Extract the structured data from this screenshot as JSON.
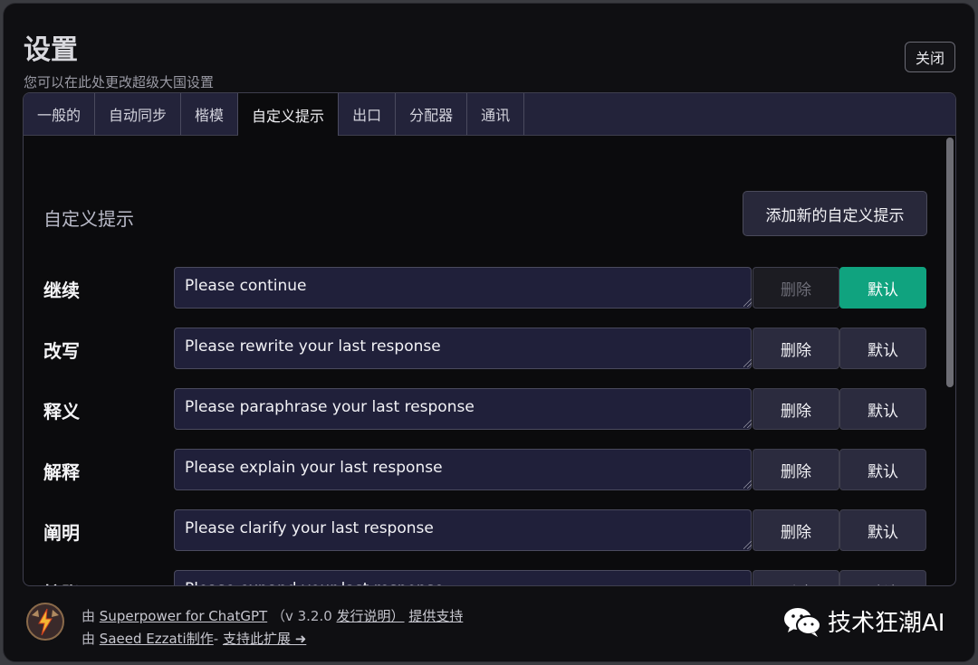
{
  "header": {
    "title": "设置",
    "subtitle": "您可以在此处更改超级大国设置",
    "close_label": "关闭"
  },
  "tabs": [
    {
      "label": "一般的",
      "active": false
    },
    {
      "label": "自动同步",
      "active": false
    },
    {
      "label": "楷模",
      "active": false
    },
    {
      "label": "自定义提示",
      "active": true
    },
    {
      "label": "出口",
      "active": false
    },
    {
      "label": "分配器",
      "active": false
    },
    {
      "label": "通讯",
      "active": false
    }
  ],
  "prompts_section": {
    "title": "自定义提示",
    "add_button_label": "添加新的自定义提示",
    "delete_label": "删除",
    "default_label": "默认",
    "rows": [
      {
        "label": "继续",
        "value": "Please continue"
      },
      {
        "label": "改写",
        "value": "Please rewrite your last response"
      },
      {
        "label": "释义",
        "value": "Please paraphrase your last response"
      },
      {
        "label": "解释",
        "value": "Please explain your last response"
      },
      {
        "label": "阐明",
        "value": "Please clarify your last response"
      },
      {
        "label": "扩张",
        "value": "Please expand your last response"
      }
    ]
  },
  "footer": {
    "line1_prefix": "由",
    "line1_link": "Superpower for ChatGPT",
    "line1_version": "（v 3.2.0",
    "line1_release_notes": "发行说明）",
    "line1_suffix": "提供支持",
    "line2_prefix": "由",
    "line2_author": "Saeed Ezzati制作",
    "line2_sep": "-",
    "line2_support": "支持此扩展 ➜"
  },
  "watermark": {
    "text": "技术狂潮AI",
    "icon": "wechat-icon"
  },
  "colors": {
    "accent_green": "#10a37f",
    "panel_bg": "#0b0b0d",
    "tab_bar_bg": "#23233a"
  }
}
